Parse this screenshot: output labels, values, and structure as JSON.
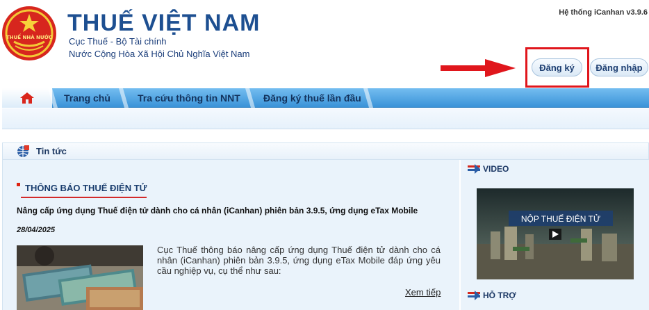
{
  "header": {
    "logo_text": "THUẾ NHÀ NƯỚC",
    "title": "THUẾ VIỆT NAM",
    "subtitle_line1": "Cục Thuế - Bộ Tài chính",
    "subtitle_line2": "Nước Cộng Hòa Xã Hội Chủ Nghĩa Việt Nam",
    "system_version": "Hệ thống iCanhan v3.9.6",
    "register_label": "Đăng ký",
    "login_label": "Đăng nhập"
  },
  "nav": {
    "tabs": [
      {
        "label": "Trang chủ"
      },
      {
        "label": "Tra cứu thông tin NNT"
      },
      {
        "label": "Đăng ký thuế lần đầu"
      }
    ]
  },
  "news": {
    "section_label": "Tin tức",
    "heading": "THÔNG BÁO THUẾ ĐIỆN TỬ",
    "article": {
      "title": "Nâng cấp ứng dụng Thuế điện tử dành cho cá nhân (iCanhan) phiên bản 3.9.5, ứng dụng eTax Mobile",
      "date": "28/04/2025",
      "summary": "Cục Thuế thông báo nâng cấp ứng dụng Thuế điện tử dành cho cá nhân (iCanhan) phiên bản 3.9.5, ứng dụng eTax Mobile đáp ứng yêu cầu nghiệp vụ, cụ thể như sau:",
      "read_more": "Xem tiếp"
    }
  },
  "sidebar": {
    "video_label": "VIDEO",
    "video_caption": "NỘP THUẾ ĐIỆN TỬ",
    "support_label": "HỖ TRỢ"
  },
  "colors": {
    "brand_blue": "#1d4f91",
    "nav_blue": "#3a93d8",
    "highlight_red": "#e0161c"
  }
}
